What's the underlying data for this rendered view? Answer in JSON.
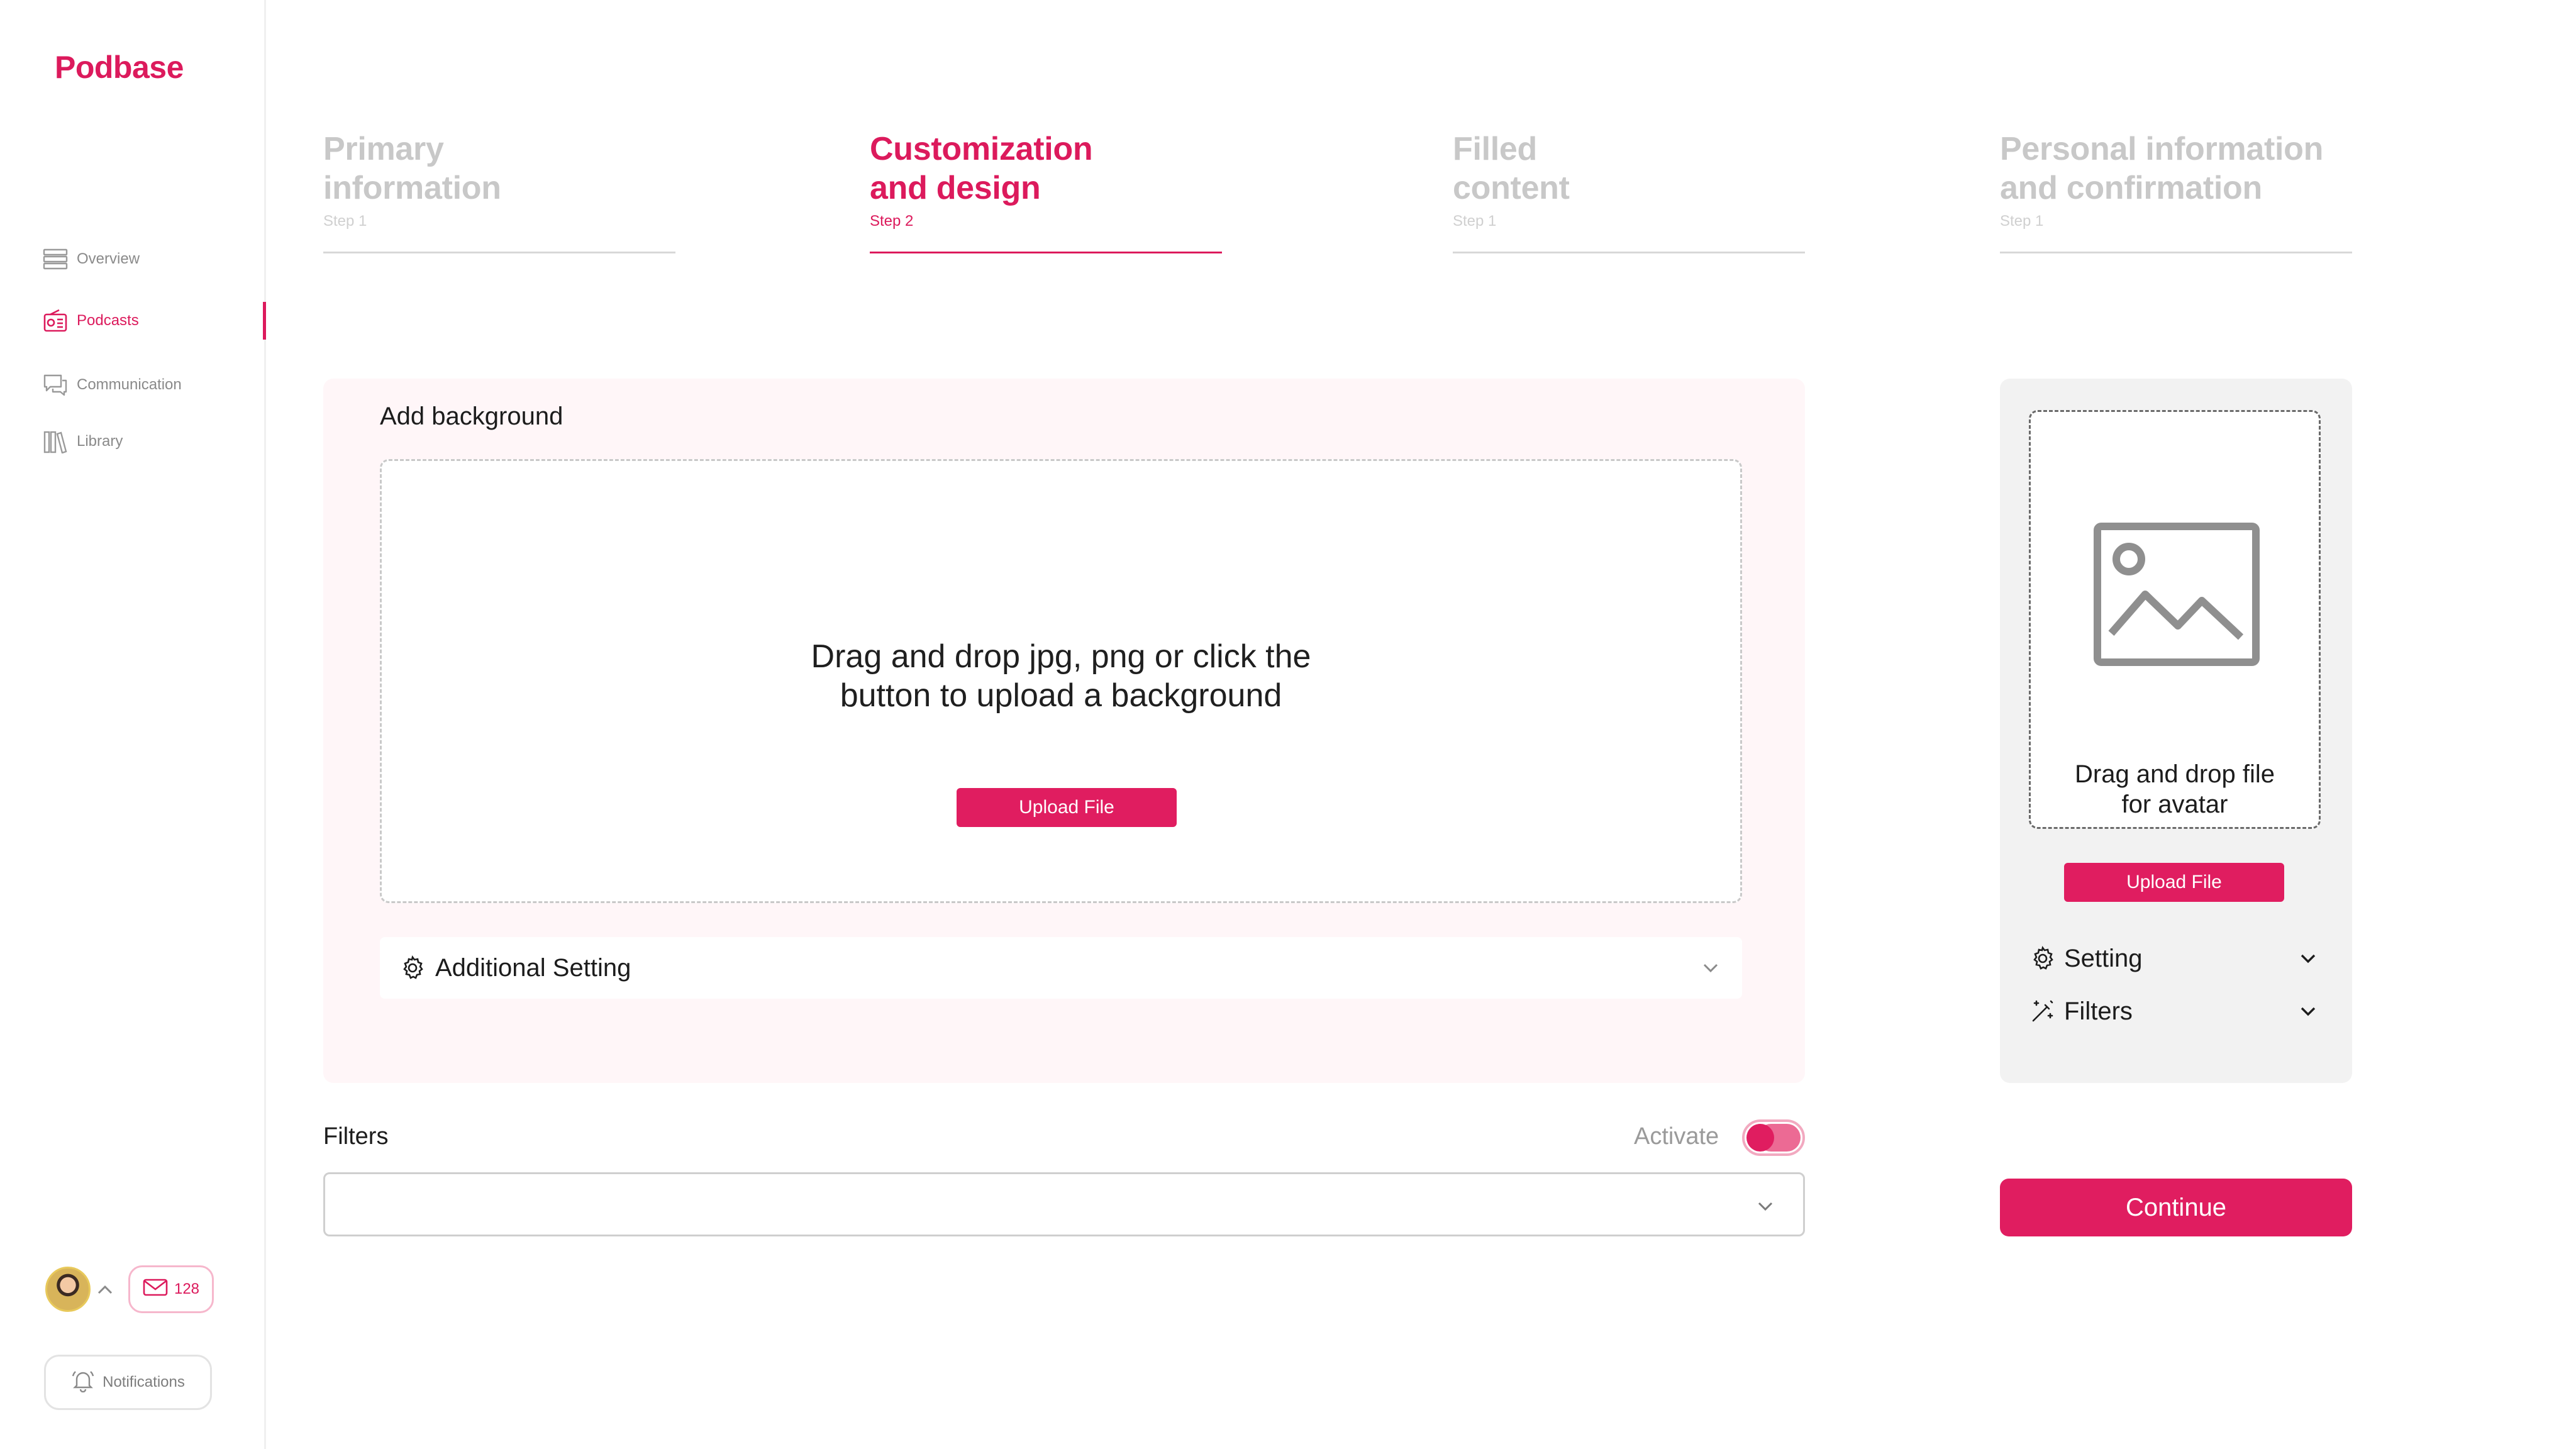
{
  "brand": {
    "name": "Podbase",
    "accent": "#dc1a5c"
  },
  "sidebar": {
    "items": [
      {
        "label": "Overview",
        "icon": "list-icon",
        "active": false
      },
      {
        "label": "Podcasts",
        "icon": "radio-icon",
        "active": true
      },
      {
        "label": "Communication",
        "icon": "chat-icon",
        "active": false
      },
      {
        "label": "Library",
        "icon": "library-icon",
        "active": false
      }
    ],
    "mail_count": "128",
    "notifications_label": "Notifications"
  },
  "steps": [
    {
      "title_line1": "Primary",
      "title_line2": "information",
      "sub": "Step 1",
      "active": false
    },
    {
      "title_line1": "Customization",
      "title_line2": "and design",
      "sub": "Step 2",
      "active": true
    },
    {
      "title_line1": "Filled",
      "title_line2": "content",
      "sub": "Step 1",
      "active": false
    },
    {
      "title_line1": "Personal information",
      "title_line2": "and confirmation",
      "sub": "Step 1",
      "active": false
    }
  ],
  "background": {
    "title": "Add background",
    "drop_line1": "Drag and drop jpg, png or click the",
    "drop_line2": "button to upload a background",
    "upload_label": "Upload File",
    "additional_setting": "Additional Setting"
  },
  "filters": {
    "label": "Filters",
    "activate_label": "Activate",
    "activated": true,
    "select_value": ""
  },
  "avatar": {
    "drop_line1": "Drag and drop file",
    "drop_line2": "for avatar",
    "upload_label": "Upload File",
    "setting_label": "Setting",
    "filters_label": "Filters"
  },
  "continue_label": "Continue"
}
